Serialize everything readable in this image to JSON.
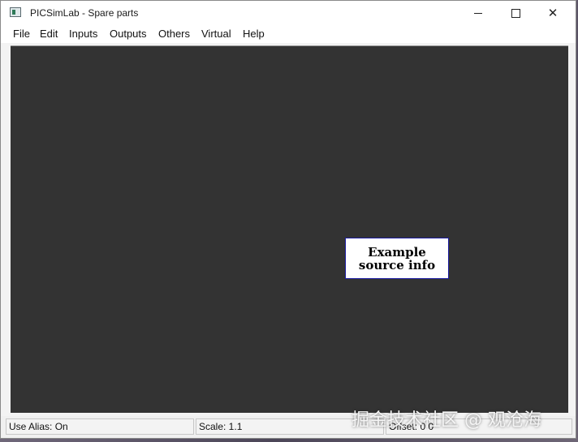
{
  "window": {
    "title": "PICSimLab - Spare parts",
    "icon": "app-icon"
  },
  "caption_buttons": {
    "minimize": "minimize-icon",
    "maximize": "maximize-icon",
    "close": "✕"
  },
  "menu": {
    "items": [
      "File",
      "Edit",
      "Inputs",
      "Outputs",
      "Others",
      "Virtual",
      "Help"
    ]
  },
  "canvas": {
    "background": "#333333",
    "part": {
      "line1": "Example",
      "line2": "source info"
    }
  },
  "status": {
    "alias": "Use Alias: On",
    "scale": "Scale: 1.1",
    "offset": "Offset:  0  0"
  },
  "watermark": "掘金技术社区 @ 观沧海"
}
